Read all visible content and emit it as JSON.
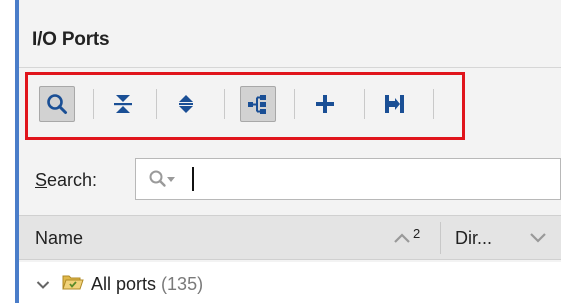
{
  "panel": {
    "title": "I/O Ports"
  },
  "toolbar": {
    "buttons": [
      {
        "name": "search",
        "icon": "magnifier-icon",
        "pressed": true
      },
      {
        "name": "collapse-all",
        "icon": "collapse-all-icon",
        "pressed": false
      },
      {
        "name": "expand-all",
        "icon": "expand-all-icon",
        "pressed": false
      },
      {
        "name": "group-by-interface",
        "icon": "group-tree-icon",
        "pressed": true
      },
      {
        "name": "add",
        "icon": "plus-icon",
        "pressed": false
      },
      {
        "name": "auto-assign",
        "icon": "auto-assign-icon",
        "pressed": false
      }
    ],
    "highlight_color": "#e0141b"
  },
  "search": {
    "label": "Search:",
    "label_mnemonic": "S",
    "label_rest": "earch:",
    "value": "",
    "placeholder": ""
  },
  "table": {
    "columns": [
      {
        "label": "Name",
        "sort": "ascending",
        "sort_order": "2"
      },
      {
        "label": "Dir..."
      }
    ]
  },
  "tree": {
    "root": {
      "label": "All ports",
      "count": "(135)",
      "expanded": true
    }
  },
  "colors": {
    "accent": "#4a7dc9",
    "icon_blue": "#1a4f95",
    "folder": "#e0b84a"
  }
}
